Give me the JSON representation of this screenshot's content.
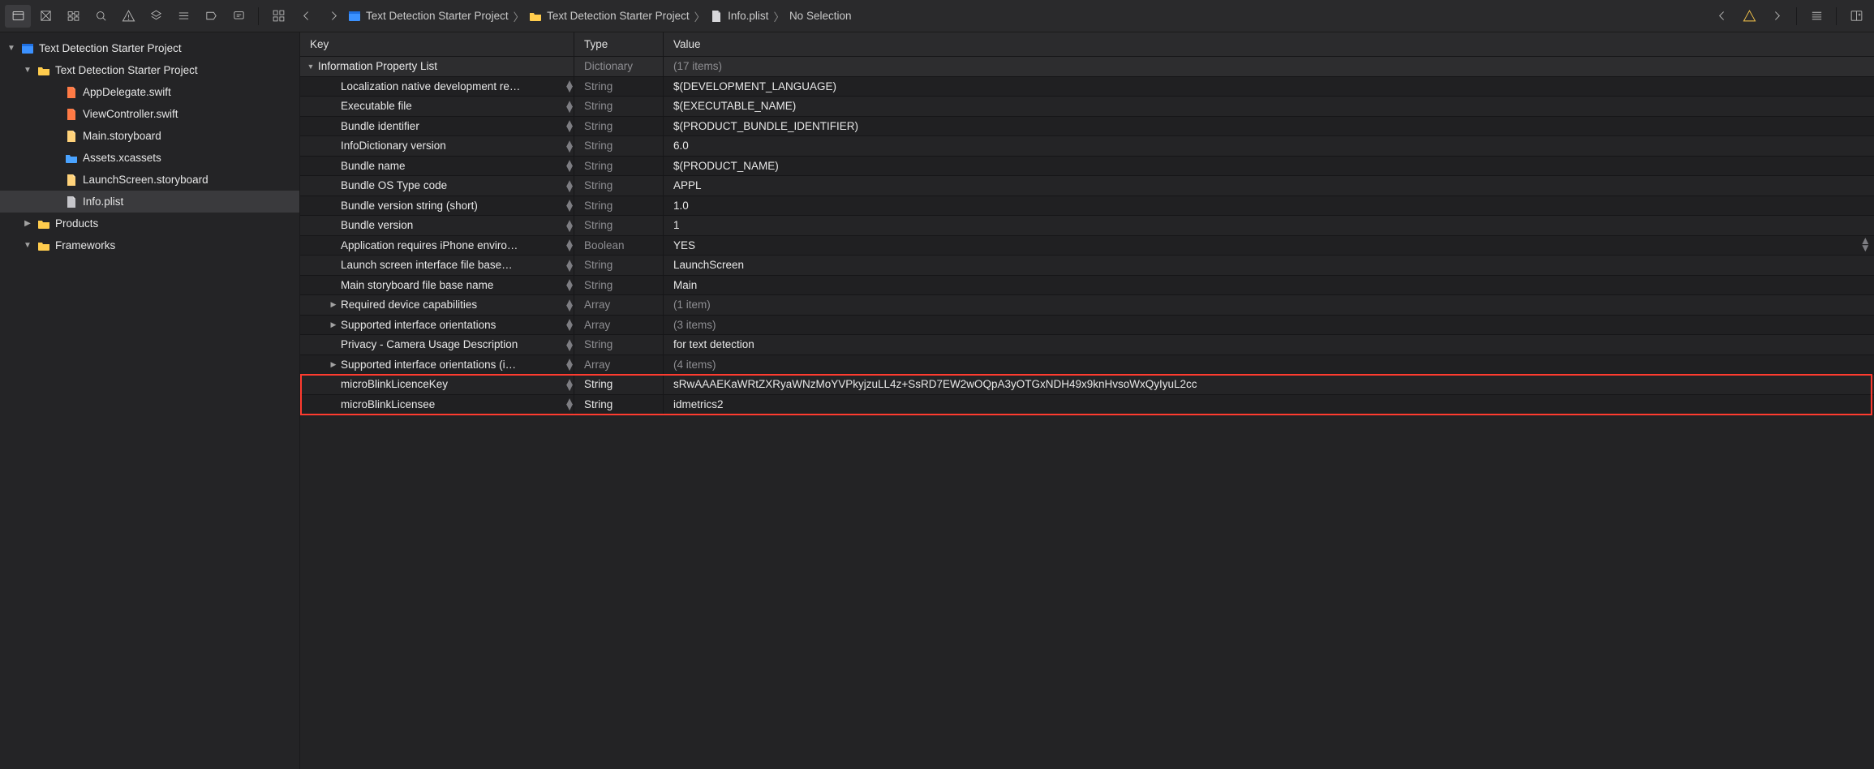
{
  "breadcrumb": {
    "nav_back": "‹",
    "nav_fwd": "›",
    "segs": [
      {
        "label": "Text Detection Starter Project",
        "icon": "project"
      },
      {
        "label": "Text Detection Starter Project",
        "icon": "folder"
      },
      {
        "label": "Info.plist",
        "icon": "plist"
      },
      {
        "label": "No Selection",
        "icon": ""
      }
    ]
  },
  "issue_nav": {
    "prev": "‹",
    "warn": "⚠︎",
    "next": "›"
  },
  "nav": {
    "root": "Text Detection Starter Project",
    "group": "Text Detection Starter Project",
    "files": [
      {
        "name": "AppDelegate.swift",
        "kind": "swift"
      },
      {
        "name": "ViewController.swift",
        "kind": "swift"
      },
      {
        "name": "Main.storyboard",
        "kind": "sb"
      },
      {
        "name": "Assets.xcassets",
        "kind": "assets"
      },
      {
        "name": "LaunchScreen.storyboard",
        "kind": "sb"
      },
      {
        "name": "Info.plist",
        "kind": "plist",
        "selected": true
      }
    ],
    "products": "Products",
    "frameworks": "Frameworks"
  },
  "plist": {
    "columns": {
      "key": "Key",
      "type": "Type",
      "value": "Value"
    },
    "rows": [
      {
        "key": "Information Property List",
        "type": "Dictionary",
        "value": "(17 items)",
        "tri": "down",
        "indent": 0,
        "heading": true,
        "typeMuted": true,
        "showStepper": false
      },
      {
        "key": "Localization native development re…",
        "type": "String",
        "value": "$(DEVELOPMENT_LANGUAGE)",
        "indent": 1,
        "showStepper": true
      },
      {
        "key": "Executable file",
        "type": "String",
        "value": "$(EXECUTABLE_NAME)",
        "indent": 1,
        "showStepper": true
      },
      {
        "key": "Bundle identifier",
        "type": "String",
        "value": "$(PRODUCT_BUNDLE_IDENTIFIER)",
        "indent": 1,
        "showStepper": true
      },
      {
        "key": "InfoDictionary version",
        "type": "String",
        "value": "6.0",
        "indent": 1,
        "showStepper": true
      },
      {
        "key": "Bundle name",
        "type": "String",
        "value": "$(PRODUCT_NAME)",
        "indent": 1,
        "showStepper": true
      },
      {
        "key": "Bundle OS Type code",
        "type": "String",
        "value": "APPL",
        "indent": 1,
        "showStepper": true
      },
      {
        "key": "Bundle version string (short)",
        "type": "String",
        "value": "1.0",
        "indent": 1,
        "showStepper": true
      },
      {
        "key": "Bundle version",
        "type": "String",
        "value": "1",
        "indent": 1,
        "showStepper": true
      },
      {
        "key": "Application requires iPhone enviro…",
        "type": "Boolean",
        "value": "YES",
        "indent": 1,
        "showStepper": true,
        "valueStepper": true
      },
      {
        "key": "Launch screen interface file base…",
        "type": "String",
        "value": "LaunchScreen",
        "indent": 1,
        "showStepper": true
      },
      {
        "key": "Main storyboard file base name",
        "type": "String",
        "value": "Main",
        "indent": 1,
        "showStepper": true
      },
      {
        "key": "Required device capabilities",
        "type": "Array",
        "value": "(1 item)",
        "tri": "right",
        "indent": 1,
        "showStepper": true,
        "typeMuted": true
      },
      {
        "key": "Supported interface orientations",
        "type": "Array",
        "value": "(3 items)",
        "tri": "right",
        "indent": 1,
        "showStepper": true,
        "typeMuted": true
      },
      {
        "key": "Privacy - Camera Usage Description",
        "type": "String",
        "value": "for text detection",
        "indent": 1,
        "showStepper": true
      },
      {
        "key": "Supported interface orientations (i…",
        "type": "Array",
        "value": "(4 items)",
        "tri": "right",
        "indent": 1,
        "showStepper": true,
        "typeMuted": true
      },
      {
        "key": "microBlinkLicenceKey",
        "type": "String",
        "value": "sRwAAAEKaWRtZXRyaWNzMoYVPkyjzuLL4z+SsRD7EW2wOQpA3yOTGxNDH49x9knHvsoWxQyIyuL2cc",
        "indent": 1,
        "showStepper": true,
        "typeBright": true,
        "hl": true
      },
      {
        "key": "microBlinkLicensee",
        "type": "String",
        "value": "idmetrics2",
        "indent": 1,
        "showStepper": true,
        "typeBright": true,
        "hl": true
      }
    ]
  }
}
